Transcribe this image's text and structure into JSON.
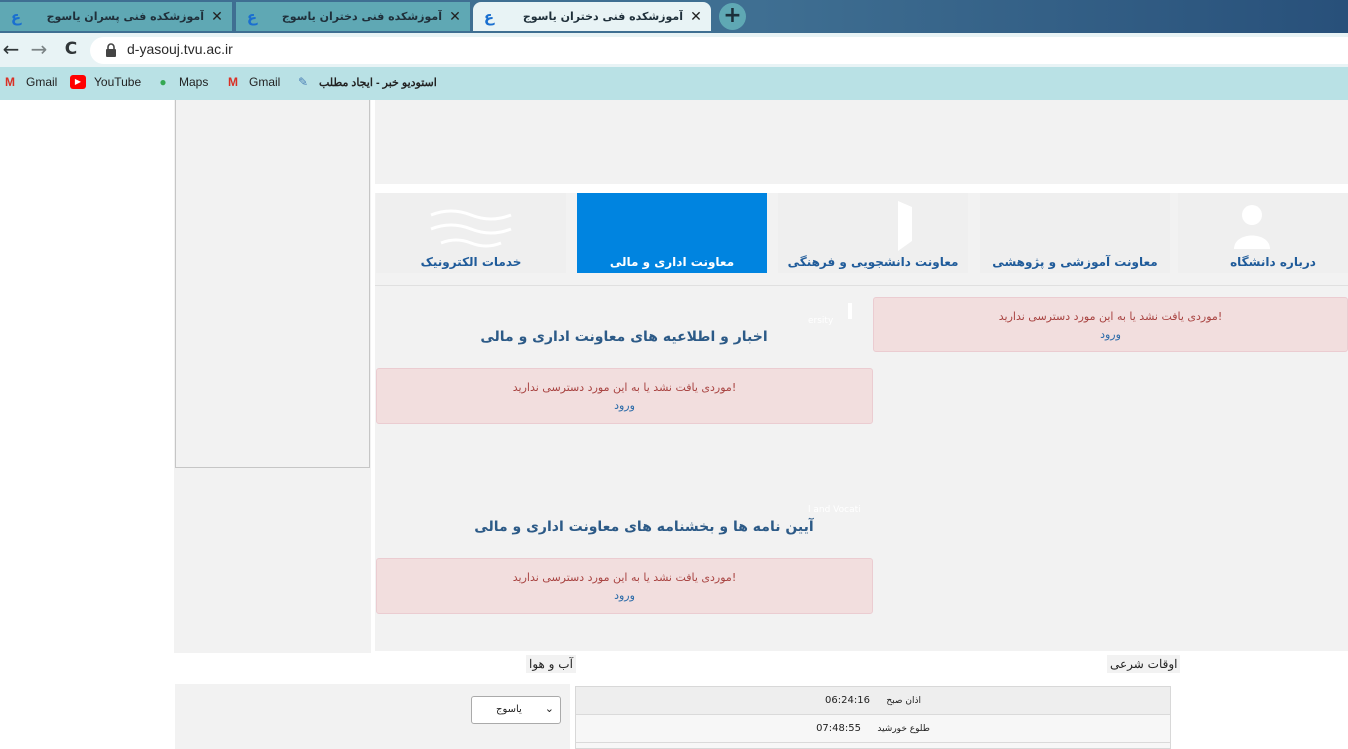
{
  "browser": {
    "tabs": [
      {
        "title": "آموزشکده فنی پسران یاسوج",
        "active": false
      },
      {
        "title": "آموزشکده فنی دختران یاسوج",
        "active": false
      },
      {
        "title": "آموزشکده فنی دختران یاسوج",
        "active": true
      }
    ],
    "tab_close_glyph": "✕",
    "new_tab_glyph": "+",
    "url": "d-yasouj.tvu.ac.ir",
    "back_glyph": "←",
    "forward_glyph": "→",
    "reload_glyph": "C",
    "bookmarks": [
      {
        "label": "Gmail",
        "icon": "gmail-icon"
      },
      {
        "label": "YouTube",
        "icon": "youtube-icon"
      },
      {
        "label": "Maps",
        "icon": "maps-icon"
      },
      {
        "label": "Gmail",
        "icon": "gmail-icon"
      },
      {
        "label": "استودیو خبر - ایجاد مطلب",
        "icon": "studio-icon"
      }
    ]
  },
  "menu": {
    "items": [
      {
        "label": "درباره دانشگاه",
        "active": false
      },
      {
        "label": "معاونت آموزشی و پژوهشی",
        "active": false
      },
      {
        "label": "معاونت دانشجویی و فرهنگی",
        "active": false
      },
      {
        "label": "معاونت اداری و مالی",
        "active": true
      },
      {
        "label": "خدمات الکترونیک",
        "active": false
      }
    ]
  },
  "alerts": {
    "message": "موردی یافت نشد یا به این مورد دسترسی ندارید!",
    "login": "ورود"
  },
  "sections": {
    "news_title": "اخبار و اطلاعیه های معاونت اداری و مالی",
    "regulations_title": "آیین نامه ها و بخشنامه های معاونت اداری و مالی",
    "ghost_1": "ersity",
    "ghost_2": "l and Vocati"
  },
  "footer": {
    "weather_title": "آب و هوا",
    "prayer_title": "اوقات شرعی",
    "city_selected": "یاسوج",
    "prayer_times": [
      {
        "label": "اذان صبح",
        "time": "06:24:16"
      },
      {
        "label": "طلوع خورشید",
        "time": "07:48:55"
      }
    ]
  },
  "colors": {
    "tab_strip": "#3f6f92",
    "active_menu": "#0084e0",
    "alert_bg": "#f2dede",
    "alert_text": "#a94442",
    "link": "#2a6aa8"
  }
}
